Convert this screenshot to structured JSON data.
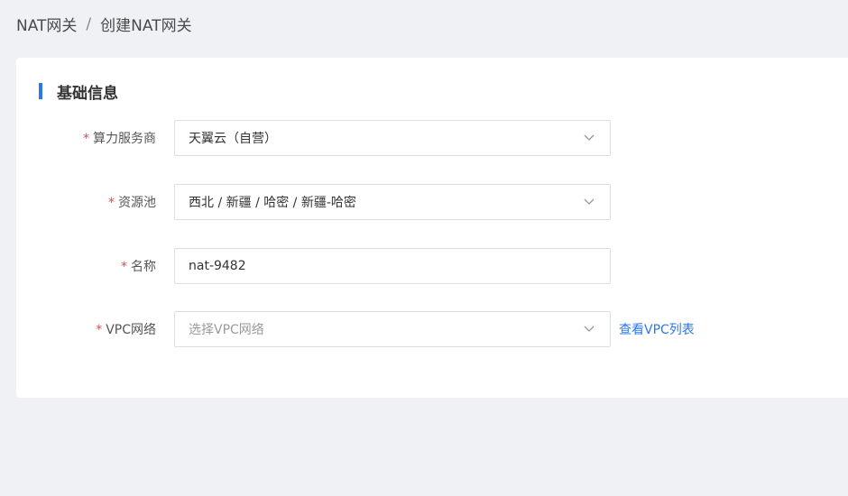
{
  "breadcrumb": {
    "parent": "NAT网关",
    "separator": "/",
    "current": "创建NAT网关"
  },
  "section": {
    "title": "基础信息"
  },
  "form": {
    "required_mark": "*",
    "provider": {
      "label": "算力服务商",
      "value": "天翼云（自营）"
    },
    "resource_pool": {
      "label": "资源池",
      "value": "西北 / 新疆 / 哈密 / 新疆-哈密"
    },
    "name": {
      "label": "名称",
      "value": "nat-9482"
    },
    "vpc": {
      "label": "VPC网络",
      "placeholder": "选择VPC网络",
      "link": "查看VPC列表"
    }
  },
  "colors": {
    "accent": "#2a77f0",
    "required": "#f04545",
    "background": "#f0f1f5"
  }
}
